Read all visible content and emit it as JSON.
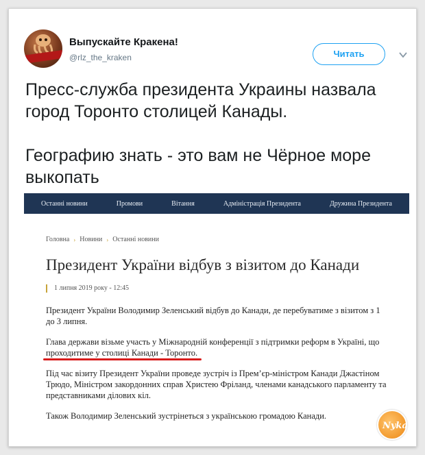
{
  "tweet": {
    "user_name": "Выпускайте Кракена!",
    "user_handle": "@rlz_the_kraken",
    "follow_label": "Читать",
    "avatar_icon": "kraken-news-avatar",
    "text_lines": [
      "Пресс-служба президента Украины назвала город Торонто столицей Канады.",
      "Географию знать - это вам не Чёрное море выкопать"
    ]
  },
  "site": {
    "nav": [
      "Останні новини",
      "Промови",
      "Вітання",
      "Адміністрація Президента",
      "Дружина Президента"
    ],
    "breadcrumbs": [
      "Головна",
      "Новини",
      "Останні новини"
    ],
    "title": "Президент України відбув з візитом до Канади",
    "date": "1 липня 2019 року - 12:45",
    "paragraphs": {
      "p1": "Президент України Володимир Зеленський відбув до Канади, де перебуватиме з візитом з 1 до 3 липня.",
      "p2_before": "Глава держави візьме участь у Міжнародній конференції з підтримки реформ в Україні, що ",
      "p2_marked": "проходитиме у столиці Канади - Торонто.",
      "p3": "Під час візиту Президент України проведе зустріч із Прем’єр-міністром Канади Джастіном Трюдо, Міністром закордонних справ Христею Фріланд, членами канадського парламенту та представниками ділових кіл.",
      "p4": "Також Володимир Зеленський зустрінеться з українською громадою Канади."
    }
  },
  "colors": {
    "follow_blue": "#1da1f2",
    "nav_bg": "#1f3554",
    "highlight_red": "#d81c1c",
    "accent_gold": "#c7a43a"
  },
  "watermark": {
    "icon": "nyka-logo-badge",
    "text": "Nyka"
  }
}
